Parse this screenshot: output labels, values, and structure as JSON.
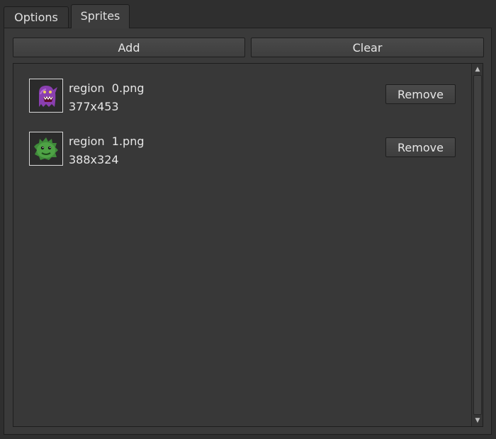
{
  "tabs": [
    {
      "label": "Options",
      "active": false
    },
    {
      "label": "Sprites",
      "active": true
    }
  ],
  "toolbar": {
    "add_label": "Add",
    "clear_label": "Clear"
  },
  "sprites": [
    {
      "name": "region  0.png",
      "size": "377x453",
      "icon": "purple-ghost-monster-icon",
      "remove_label": "Remove"
    },
    {
      "name": "region  1.png",
      "size": "388x324",
      "icon": "green-spiky-monster-icon",
      "remove_label": "Remove"
    }
  ],
  "colors": {
    "background": "#2f2f2f",
    "panel": "#3a3a3a",
    "text": "#e2e2e2",
    "border": "#1e1e1e"
  }
}
